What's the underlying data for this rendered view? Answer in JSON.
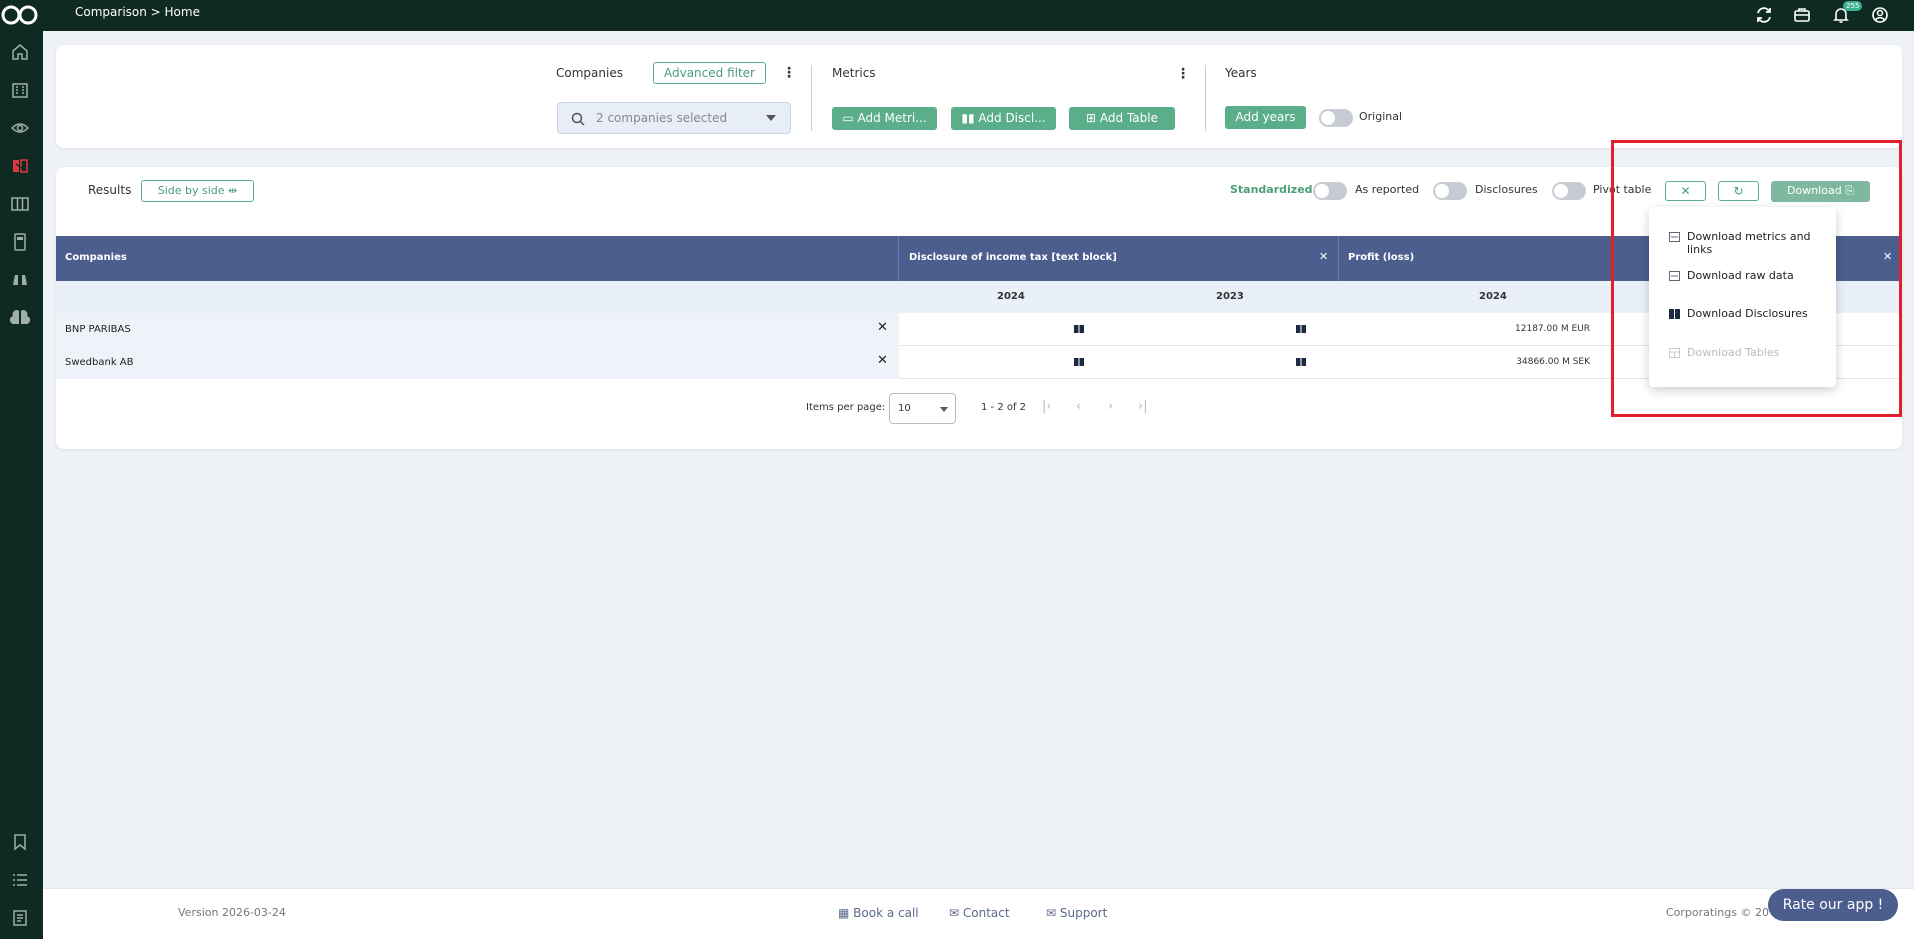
{
  "topbar": {
    "breadcrumb": "Comparison >  Home",
    "notification_count": "255"
  },
  "filters": {
    "companies_label": "Companies",
    "advanced_filter": "Advanced filter",
    "companies_selected": "2 companies selected",
    "metrics_label": "Metrics",
    "add_metric": "Add Metri...",
    "add_disclosure": "Add Discl...",
    "add_table": "Add Table",
    "years_label": "Years",
    "add_years": "Add years",
    "original_label": "Original"
  },
  "results": {
    "title": "Results",
    "side_by_side": "Side by side",
    "standardized": "Standardized",
    "as_reported": "As reported",
    "disclosures": "Disclosures",
    "pivot_table": "Pivot table",
    "download": "Download"
  },
  "table": {
    "columns": [
      "Companies",
      "Disclosure of income tax [text block]",
      "Profit (loss)"
    ],
    "years": [
      "2024",
      "2023",
      "2024"
    ],
    "rows": [
      {
        "name": "BNP PARIBAS",
        "profit": "12187.00 M EUR"
      },
      {
        "name": "Swedbank AB",
        "profit": "34866.00 M SEK"
      }
    ]
  },
  "pagination": {
    "items_per_page_label": "Items per page:",
    "items_per_page": "10",
    "range": "1 - 2 of 2"
  },
  "download_menu": {
    "items": [
      {
        "label": "Download metrics and links",
        "enabled": true
      },
      {
        "label": "Download raw data",
        "enabled": true
      },
      {
        "label": "Download Disclosures",
        "enabled": true
      },
      {
        "label": "Download Tables",
        "enabled": false
      }
    ]
  },
  "footer": {
    "version": "Version 2026-03-24",
    "book_call": "Book a call",
    "contact": "Contact",
    "support": "Support",
    "copyright": "Corporatings © 20",
    "rate_app": "Rate our app !"
  },
  "colors": {
    "dark": "#0f2a22",
    "green": "#5aae8a",
    "header_blue": "#4b5e8e",
    "highlight_red": "#e0202a"
  }
}
